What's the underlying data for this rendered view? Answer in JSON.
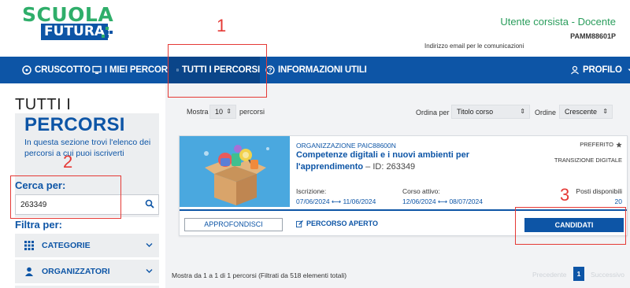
{
  "header": {
    "logo_top": "SCUOLA",
    "logo_bottom": "FUTURA",
    "user_role": "Utente corsista - Docente",
    "user_code": "PAMM88601P",
    "email_notice": "Indirizzo email per le comunicazioni"
  },
  "nav": {
    "items": [
      {
        "label": "CRUSCOTTO",
        "icon": "dashboard-icon"
      },
      {
        "label": "I MIEI PERCORSI",
        "icon": "monitor-icon"
      },
      {
        "label": "TUTTI I PERCORSI",
        "icon": "list-icon",
        "active": true
      },
      {
        "label": "INFORMAZIONI UTILI",
        "icon": "question-icon"
      }
    ],
    "profile": "PROFILO"
  },
  "sidebar": {
    "title_light": "TUTTI I",
    "title_bold": "PERCORSI",
    "description": "In questa sezione trovi l'elenco dei percorsi a cui puoi iscriverti",
    "search_label": "Cerca per:",
    "search_value": "263349",
    "filter_label": "Filtra per:",
    "filters": [
      {
        "label": "CATEGORIE",
        "icon": "grid-icon"
      },
      {
        "label": "ORGANIZZATORI",
        "icon": "user-icon"
      }
    ]
  },
  "toolbar": {
    "show_label": "Mostra",
    "show_value": "10",
    "show_suffix": "percorsi",
    "sort_label": "Ordina per",
    "sort_value": "Titolo corso",
    "order_label": "Ordine",
    "order_value": "Crescente"
  },
  "course": {
    "organization": "ORGANIZZAZIONE PAIC88600N",
    "title": "Competenze digitali e i nuovi ambienti per l'apprendimento",
    "id_text": " – ID: 263349",
    "favorite": "PREFERITO",
    "area": "TRANSIZIONE DIGITALE",
    "enrollment_label": "Iscrizione:",
    "enrollment_value": "07/06/2024 ⟷ 11/06/2024",
    "active_label": "Corso attivo:",
    "active_value": "12/06/2024 ⟷ 08/07/2024",
    "seats_label": "Posti disponibili",
    "seats_value": "20",
    "details_button": "APPROFONDISCI",
    "status": "PERCORSO APERTO",
    "apply_button": "CANDIDATI"
  },
  "footer": {
    "summary": "Mostra da 1 a 1 di 1 percorsi (Filtrati da 518 elementi totali)",
    "prev": "Precedente",
    "page": "1",
    "next": "Successivo"
  },
  "annotations": [
    "1",
    "2",
    "3"
  ],
  "colors": {
    "brand_blue": "#0d55a6",
    "brand_green": "#2fae6a",
    "annotation_red": "#e53935"
  }
}
